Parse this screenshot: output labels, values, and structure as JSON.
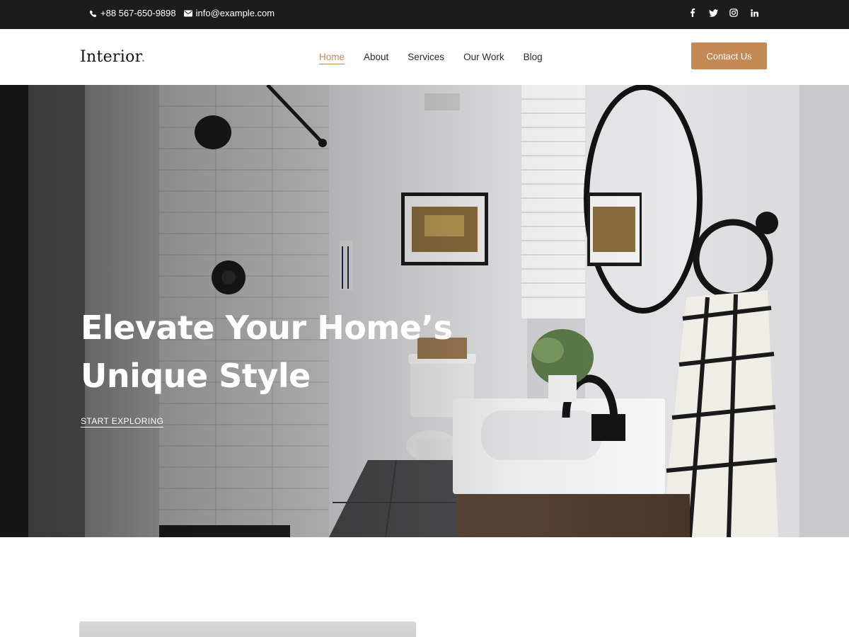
{
  "topbar": {
    "phone": "+88 567-650-9898",
    "email": "info@example.com",
    "social": [
      {
        "name": "facebook-icon"
      },
      {
        "name": "twitter-icon"
      },
      {
        "name": "instagram-icon"
      },
      {
        "name": "linkedin-icon"
      }
    ]
  },
  "header": {
    "logo_text": "Interior",
    "logo_dot": ".",
    "nav": [
      {
        "label": "Home",
        "active": true
      },
      {
        "label": "About"
      },
      {
        "label": "Services"
      },
      {
        "label": "Our Work"
      },
      {
        "label": "Blog"
      }
    ],
    "cta_label": "Contact Us"
  },
  "hero": {
    "title_line1": "Elevate Your Home’s",
    "title_line2": "Unique Style",
    "link_label": "START EXPLORING"
  },
  "colors": {
    "accent": "#c48a55",
    "topbar_bg": "#1c1c1c"
  }
}
